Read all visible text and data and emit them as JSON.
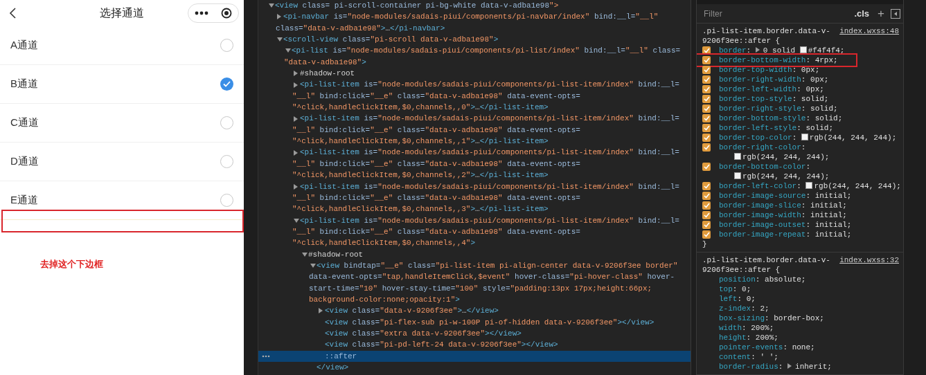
{
  "phone": {
    "title": "选择通道",
    "channels": [
      {
        "label": "A通道",
        "selected": false
      },
      {
        "label": "B通道",
        "selected": true
      },
      {
        "label": "C通道",
        "selected": false
      },
      {
        "label": "D通道",
        "selected": false
      },
      {
        "label": "E通道",
        "selected": false
      }
    ],
    "annotation": {
      "note": "去掉这个下边框"
    }
  },
  "elements": {
    "nodes": [
      {
        "lines": [
          "<view class= pi-scroll-container pi-bg-white data-v-adba1e98\">"
        ],
        "expanded": true,
        "selected": false,
        "children": [
          {
            "lines": [
              "<pi-navbar is=\"node-modules/sadais-piui/components/pi-navbar/index\" bind:__l=\"__l\"",
              "class=\"data-v-adba1e98\">…</pi-navbar>"
            ],
            "expanded": false,
            "selected": false
          },
          {
            "lines": [
              "<scroll-view class=\"pi-scroll data-v-adba1e98\">"
            ],
            "expanded": true,
            "selected": false,
            "children": [
              {
                "lines": [
                  "<pi-list is=\"node-modules/sadais-piui/components/pi-list/index\" bind:__l=\"__l\" class=",
                  "\"data-v-adba1e98\">"
                ],
                "expanded": true,
                "selected": false,
                "children": [
                  {
                    "lines": [
                      "#shadow-root"
                    ],
                    "expanded": false,
                    "selected": false
                  },
                  {
                    "lines": [
                      "<pi-list-item is=\"node-modules/sadais-piui/components/pi-list-item/index\" bind:__l=",
                      "\"__l\" bind:click=\"__e\" class=\"data-v-adba1e98\" data-event-opts=",
                      "\"^click,handleClickItem,$0,channels,,0\">…</pi-list-item>"
                    ],
                    "expanded": false,
                    "selected": false
                  },
                  {
                    "lines": [
                      "<pi-list-item is=\"node-modules/sadais-piui/components/pi-list-item/index\" bind:__l=",
                      "\"__l\" bind:click=\"__e\" class=\"data-v-adba1e98\" data-event-opts=",
                      "\"^click,handleClickItem,$0,channels,,1\">…</pi-list-item>"
                    ],
                    "expanded": false,
                    "selected": false
                  },
                  {
                    "lines": [
                      "<pi-list-item is=\"node-modules/sadais-piui/components/pi-list-item/index\" bind:__l=",
                      "\"__l\" bind:click=\"__e\" class=\"data-v-adba1e98\" data-event-opts=",
                      "\"^click,handleClickItem,$0,channels,,2\">…</pi-list-item>"
                    ],
                    "expanded": false,
                    "selected": false
                  },
                  {
                    "lines": [
                      "<pi-list-item is=\"node-modules/sadais-piui/components/pi-list-item/index\" bind:__l=",
                      "\"__l\" bind:click=\"__e\" class=\"data-v-adba1e98\" data-event-opts=",
                      "\"^click,handleClickItem,$0,channels,,3\">…</pi-list-item>"
                    ],
                    "expanded": false,
                    "selected": false
                  },
                  {
                    "lines": [
                      "<pi-list-item is=\"node-modules/sadais-piui/components/pi-list-item/index\" bind:__l=",
                      "\"__l\" bind:click=\"__e\" class=\"data-v-adba1e98\" data-event-opts=",
                      "\"^click,handleClickItem,$0,channels,,4\">"
                    ],
                    "expanded": true,
                    "selected": false,
                    "children": [
                      {
                        "lines": [
                          "#shadow-root"
                        ],
                        "expanded": true,
                        "selected": false,
                        "children": [
                          {
                            "lines": [
                              "<view bindtap=\"__e\" class=\"pi-list-item pi-align-center data-v-9206f3ee border\"",
                              "data-event-opts=\"tap,handleItemClick,$event\" hover-class=\"pi-hover-class\" hover-",
                              "start-time=\"10\" hover-stay-time=\"100\" style=\"padding:13px 17px;height:66px;",
                              "background-color:none;opacity:1\">"
                            ],
                            "expanded": true,
                            "selected": false,
                            "closing": "</view>",
                            "children": [
                              {
                                "lines": [
                                  "<view class=\"data-v-9206f3ee\">…</view>"
                                ],
                                "expanded": false,
                                "selected": false
                              },
                              {
                                "lines": [
                                  "<view class=\"pi-flex-sub pi-w-100P pi-of-hidden data-v-9206f3ee\"></view>"
                                ],
                                "selected": false
                              },
                              {
                                "lines": [
                                  "<view class=\"extra data-v-9206f3ee\"></view>"
                                ],
                                "selected": false
                              },
                              {
                                "lines": [
                                  "<view class=\"pi-pd-left-24 data-v-9206f3ee\"></view>"
                                ],
                                "selected": false
                              },
                              {
                                "lines": [
                                  "::after"
                                ],
                                "selected": true
                              }
                            ]
                          }
                        ]
                      }
                    ]
                  }
                ]
              }
            ]
          }
        ]
      }
    ]
  },
  "styles": {
    "filter": {
      "placeholder": "Filter"
    },
    "cls_button": ".cls",
    "add_button": "+",
    "rules": [
      {
        "selector": [
          ".pi-list-item.border.data-v-",
          "9206f3ee::after {"
        ],
        "source": "index.wxss:48",
        "close": "}",
        "props": [
          {
            "name": "border",
            "sep": ":",
            "checked": true,
            "highlighted": false,
            "value": [
              {
                "kind": "expander"
              },
              {
                "kind": "text",
                "text": "0 solid"
              },
              {
                "kind": "swatch",
                "color": "#f4f4f4"
              },
              {
                "kind": "text",
                "text": "#f4f4f4;"
              }
            ]
          },
          {
            "name": "border-bottom-width",
            "sep": ":",
            "checked": true,
            "highlighted": true,
            "value": [
              {
                "kind": "text",
                "text": "4rpx;"
              }
            ]
          },
          {
            "name": "border-top-width",
            "sep": ":",
            "checked": true,
            "highlighted": false,
            "value": [
              {
                "kind": "text",
                "text": "0px;"
              }
            ]
          },
          {
            "name": "border-right-width",
            "sep": ":",
            "checked": true,
            "highlighted": false,
            "value": [
              {
                "kind": "text",
                "text": "0px;"
              }
            ]
          },
          {
            "name": "border-left-width",
            "sep": ":",
            "checked": true,
            "highlighted": false,
            "value": [
              {
                "kind": "text",
                "text": "0px;"
              }
            ]
          },
          {
            "name": "border-top-style",
            "sep": ":",
            "checked": true,
            "highlighted": false,
            "value": [
              {
                "kind": "text",
                "text": "solid;"
              }
            ]
          },
          {
            "name": "border-right-style",
            "sep": ":",
            "checked": true,
            "highlighted": false,
            "value": [
              {
                "kind": "text",
                "text": "solid;"
              }
            ]
          },
          {
            "name": "border-bottom-style",
            "sep": ":",
            "checked": true,
            "highlighted": false,
            "value": [
              {
                "kind": "text",
                "text": "solid;"
              }
            ]
          },
          {
            "name": "border-left-style",
            "sep": ":",
            "checked": true,
            "highlighted": false,
            "value": [
              {
                "kind": "text",
                "text": "solid;"
              }
            ]
          },
          {
            "name": "border-top-color",
            "sep": ":",
            "checked": true,
            "highlighted": false,
            "value": [
              {
                "kind": "swatch",
                "color": "#f4f4f4"
              },
              {
                "kind": "text",
                "text": "rgb(244, 244, 244);"
              }
            ]
          },
          {
            "name": "border-right-color",
            "sep": ":",
            "checked": true,
            "highlighted": false,
            "value": [
              {
                "kind": "swatch",
                "color": "#f4f4f4"
              },
              {
                "kind": "text",
                "text": "rgb(244, 244, 244);"
              }
            ]
          },
          {
            "name": "border-bottom-color",
            "sep": ":",
            "checked": true,
            "highlighted": false,
            "value": [
              {
                "kind": "swatch",
                "color": "#f4f4f4"
              },
              {
                "kind": "text",
                "text": "rgb(244, 244, 244);"
              }
            ]
          },
          {
            "name": "border-left-color",
            "sep": ":",
            "checked": true,
            "highlighted": false,
            "value": [
              {
                "kind": "swatch",
                "color": "#f4f4f4"
              },
              {
                "kind": "text",
                "text": "rgb(244, 244, 244);"
              }
            ]
          },
          {
            "name": "border-image-source",
            "sep": ":",
            "checked": true,
            "highlighted": false,
            "value": [
              {
                "kind": "text",
                "text": "initial;"
              }
            ]
          },
          {
            "name": "border-image-slice",
            "sep": ":",
            "checked": true,
            "highlighted": false,
            "value": [
              {
                "kind": "text",
                "text": "initial;"
              }
            ]
          },
          {
            "name": "border-image-width",
            "sep": ":",
            "checked": true,
            "highlighted": false,
            "value": [
              {
                "kind": "text",
                "text": "initial;"
              }
            ]
          },
          {
            "name": "border-image-outset",
            "sep": ":",
            "checked": true,
            "highlighted": false,
            "value": [
              {
                "kind": "text",
                "text": "initial;"
              }
            ]
          },
          {
            "name": "border-image-repeat",
            "sep": ":",
            "checked": true,
            "highlighted": false,
            "value": [
              {
                "kind": "text",
                "text": "initial;"
              }
            ]
          }
        ]
      },
      {
        "selector": [
          ".pi-list-item.border.data-v-",
          "9206f3ee::after {"
        ],
        "source": "index.wxss:32",
        "props": [
          {
            "name": "position",
            "sep": ":",
            "value": [
              {
                "kind": "text",
                "text": "absolute;"
              }
            ]
          },
          {
            "name": "top",
            "sep": ":",
            "value": [
              {
                "kind": "text",
                "text": "0;"
              }
            ]
          },
          {
            "name": "left",
            "sep": ":",
            "value": [
              {
                "kind": "text",
                "text": "0;"
              }
            ]
          },
          {
            "name": "z-index",
            "sep": ":",
            "value": [
              {
                "kind": "text",
                "text": "2;"
              }
            ]
          },
          {
            "name": "box-sizing",
            "sep": ":",
            "value": [
              {
                "kind": "text",
                "text": "border-box;"
              }
            ]
          },
          {
            "name": "width",
            "sep": ":",
            "value": [
              {
                "kind": "text",
                "text": "200%;"
              }
            ]
          },
          {
            "name": "height",
            "sep": ":",
            "value": [
              {
                "kind": "text",
                "text": "200%;"
              }
            ]
          },
          {
            "name": "pointer-events",
            "sep": ":",
            "value": [
              {
                "kind": "text",
                "text": "none;"
              }
            ]
          },
          {
            "name": "content",
            "sep": ":",
            "value": [
              {
                "kind": "text",
                "text": "' ';"
              }
            ]
          },
          {
            "name": "border-radius",
            "sep": ":",
            "value": [
              {
                "kind": "expander"
              },
              {
                "kind": "text",
                "text": "inherit;"
              }
            ]
          }
        ]
      }
    ]
  }
}
